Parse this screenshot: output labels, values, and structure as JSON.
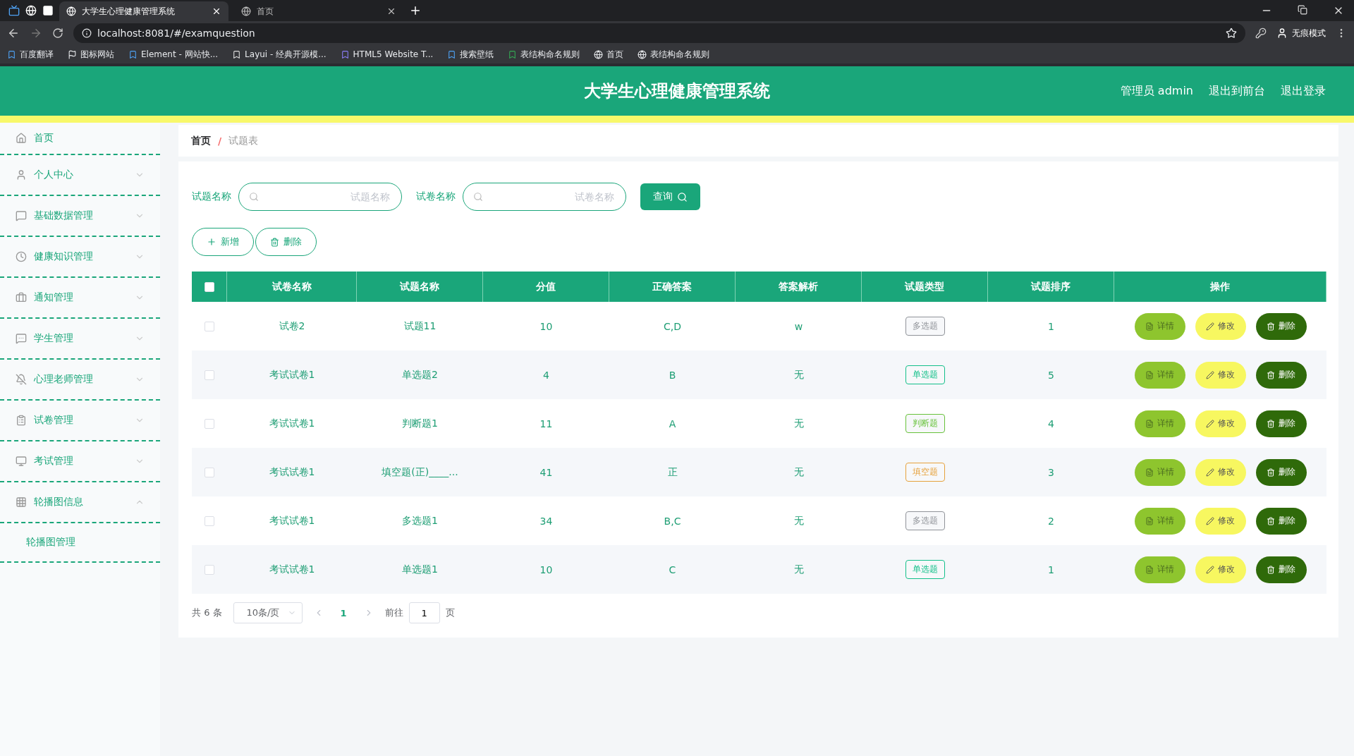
{
  "browser": {
    "tabs": [
      {
        "label": "大学生心理健康管理系统",
        "selected": true
      },
      {
        "label": "首页",
        "selected": false
      }
    ],
    "url": "localhost:8081/#/examquestion",
    "profile": "无痕模式",
    "bookmarks": [
      "百度翻译",
      "图标网站",
      "Element - 网站快...",
      "Layui - 经典开源模...",
      "HTML5 Website T...",
      "搜索壁纸",
      "表结构命名规则",
      "首页",
      "表结构命名规则"
    ]
  },
  "header": {
    "title": "大学生心理健康管理系统",
    "user": "管理员 admin",
    "links": [
      "退出到前台",
      "退出登录"
    ]
  },
  "sidebar": {
    "items": [
      {
        "label": "首页",
        "kind": "link"
      },
      {
        "label": "个人中心",
        "kind": "submenu",
        "expanded": false
      },
      {
        "label": "基础数据管理",
        "kind": "submenu",
        "expanded": false
      },
      {
        "label": "健康知识管理",
        "kind": "submenu",
        "expanded": false
      },
      {
        "label": "通知管理",
        "kind": "submenu",
        "expanded": false
      },
      {
        "label": "学生管理",
        "kind": "submenu",
        "expanded": false
      },
      {
        "label": "心理老师管理",
        "kind": "submenu",
        "expanded": false
      },
      {
        "label": "试卷管理",
        "kind": "submenu",
        "expanded": false
      },
      {
        "label": "考试管理",
        "kind": "submenu",
        "expanded": false
      },
      {
        "label": "轮播图信息",
        "kind": "submenu",
        "expanded": true,
        "children": [
          {
            "label": "轮播图管理"
          }
        ]
      }
    ]
  },
  "breadcrumb": {
    "items": [
      "首页",
      "试题表"
    ],
    "separator": "/"
  },
  "search": {
    "fields": [
      {
        "label": "试题名称",
        "placeholder": "试题名称"
      },
      {
        "label": "试卷名称",
        "placeholder": "试卷名称"
      }
    ],
    "button": "查询"
  },
  "actions": [
    "新增",
    "删除"
  ],
  "table": {
    "all_checked": false,
    "columns": [
      "试卷名称",
      "试题名称",
      "分值",
      "正确答案",
      "答案解析",
      "试题类型",
      "试题排序",
      "操作"
    ],
    "rows": [
      {
        "checked": false,
        "cells": [
          "试卷2",
          "试题11",
          "10",
          "C,D",
          "w"
        ],
        "type": {
          "label": "多选题",
          "color": "#909399"
        },
        "order": "1",
        "buttons": [
          "详情",
          "修改",
          "删除"
        ]
      },
      {
        "checked": false,
        "cells": [
          "考试试卷1",
          "单选题2",
          "4",
          "B",
          "无"
        ],
        "type": {
          "label": "单选题",
          "color": "#13c08a"
        },
        "order": "5",
        "buttons": [
          "详情",
          "修改",
          "删除"
        ]
      },
      {
        "checked": false,
        "cells": [
          "考试试卷1",
          "判断题1",
          "11",
          "A",
          "无"
        ],
        "type": {
          "label": "判断题",
          "color": "#67c23a"
        },
        "order": "4",
        "buttons": [
          "详情",
          "修改",
          "删除"
        ]
      },
      {
        "checked": false,
        "cells": [
          "考试试卷1",
          "填空题(正)____...",
          "41",
          "正",
          "无"
        ],
        "type": {
          "label": "填空题",
          "color": "#e6a23c"
        },
        "order": "3",
        "buttons": [
          "详情",
          "修改",
          "删除"
        ]
      },
      {
        "checked": false,
        "cells": [
          "考试试卷1",
          "多选题1",
          "34",
          "B,C",
          "无"
        ],
        "type": {
          "label": "多选题",
          "color": "#909399"
        },
        "order": "2",
        "buttons": [
          "详情",
          "修改",
          "删除"
        ]
      },
      {
        "checked": false,
        "cells": [
          "考试试卷1",
          "单选题1",
          "10",
          "C",
          "无"
        ],
        "type": {
          "label": "单选题",
          "color": "#13c08a"
        },
        "order": "1",
        "buttons": [
          "详情",
          "修改",
          "删除"
        ]
      }
    ]
  },
  "pagination": {
    "total": "共 6 条",
    "page_size": "10条/页",
    "pages": [
      {
        "label": "1",
        "selected": true
      }
    ],
    "goto_label": "前往",
    "goto_value": "1",
    "goto_suffix": "页"
  }
}
